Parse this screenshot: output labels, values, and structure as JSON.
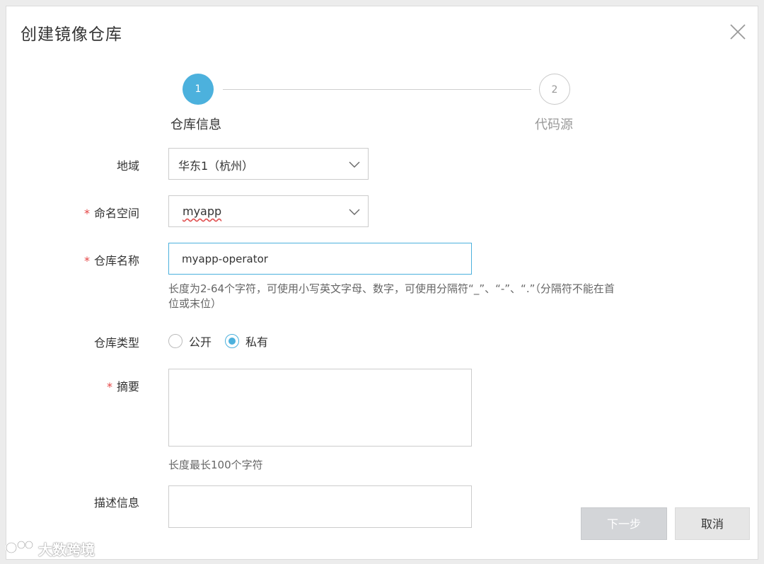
{
  "dialog": {
    "title": "创建镜像仓库"
  },
  "steps": [
    {
      "number": "1",
      "label": "仓库信息",
      "active": true
    },
    {
      "number": "2",
      "label": "代码源",
      "active": false
    }
  ],
  "form": {
    "region": {
      "label": "地域",
      "value": "华东1（杭州）"
    },
    "namespace": {
      "label": "命名空间",
      "required_mark": "*",
      "value": "myapp"
    },
    "repo_name": {
      "label": "仓库名称",
      "required_mark": "*",
      "value": "myapp-operator",
      "hint_line1": "长度为2-64个字符，可使用小写英文字母、数字，可使用分隔符“_”、“-”、“.”（分隔符不能在首",
      "hint_line2": "位或末位）"
    },
    "repo_type": {
      "label": "仓库类型",
      "options": [
        {
          "label": "公开",
          "selected": false
        },
        {
          "label": "私有",
          "selected": true
        }
      ]
    },
    "summary": {
      "label": "摘要",
      "required_mark": "*",
      "value": "",
      "hint": "长度最长100个字符"
    },
    "description": {
      "label": "描述信息",
      "value": ""
    }
  },
  "footer": {
    "next_label": "下一步",
    "cancel_label": "取消"
  },
  "watermark": {
    "text": "大数跨境"
  },
  "colors": {
    "accent": "#4cb1dd",
    "required": "#e54545",
    "disabled_button": "#d3d5d8"
  }
}
